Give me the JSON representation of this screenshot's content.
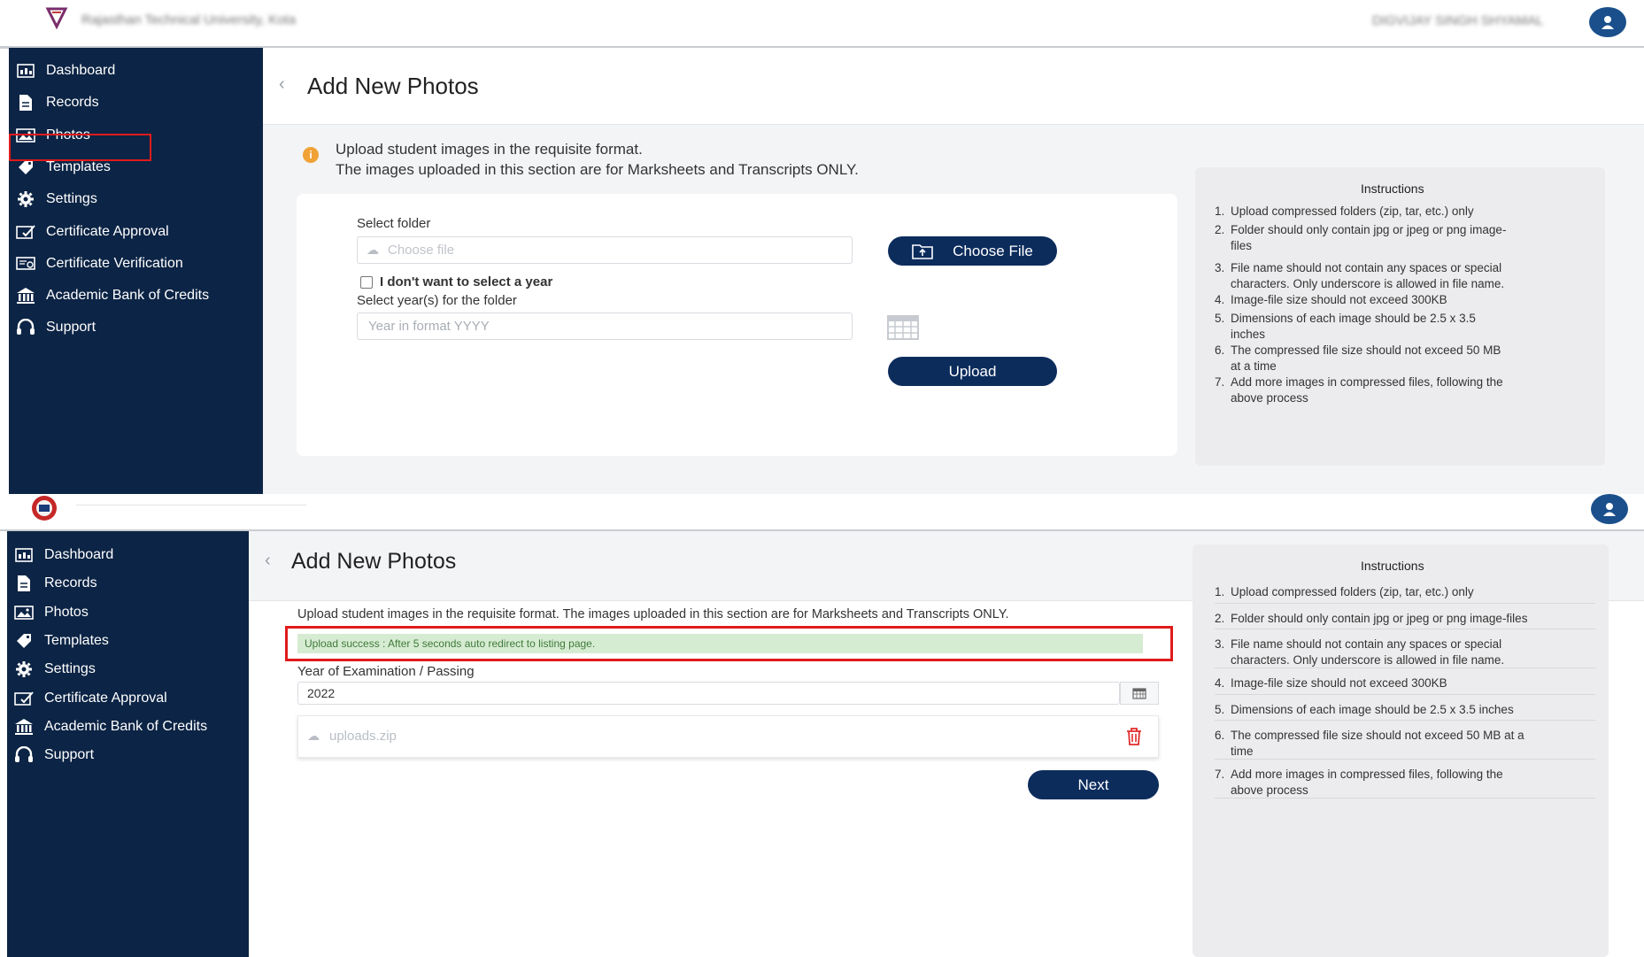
{
  "top": {
    "header": {
      "university_name": "Rajasthan Technical University, Kota",
      "user_name": "DIGVIJAY SINGH SHYAMAL"
    },
    "sidebar": {
      "items": [
        {
          "label": "Dashboard",
          "icon": "dashboard-icon"
        },
        {
          "label": "Records",
          "icon": "file-icon"
        },
        {
          "label": "Photos",
          "icon": "photos-icon"
        },
        {
          "label": "Templates",
          "icon": "tag-icon"
        },
        {
          "label": "Settings",
          "icon": "gear-icon"
        },
        {
          "label": "Certificate Approval",
          "icon": "certificate-approval-icon"
        },
        {
          "label": "Certificate Verification",
          "icon": "certificate-verification-icon"
        },
        {
          "label": "Academic Bank of Credits",
          "icon": "bank-icon"
        },
        {
          "label": "Support",
          "icon": "headset-icon"
        }
      ],
      "active": "Photos"
    },
    "page_title": "Add New Photos",
    "info_line1": "Upload student images in the requisite format.",
    "info_line2": "The images uploaded in this section are for Marksheets and Transcripts ONLY.",
    "form": {
      "select_folder_label": "Select folder",
      "file_placeholder": "Choose file",
      "choose_file_button": "Choose File",
      "no_year_checkbox_label": "I don't want to select a year",
      "no_year_checked": false,
      "select_years_label": "Select year(s) for the folder",
      "year_placeholder": "Year in format YYYY",
      "upload_button": "Upload"
    },
    "instructions": {
      "title": "Instructions",
      "items": [
        {
          "n": "1.",
          "l1": "Upload compressed folders (zip, tar, etc.) only",
          "l2": ""
        },
        {
          "n": "2.",
          "l1": "Folder should only contain jpg or jpeg or png image-",
          "l2": "files"
        },
        {
          "n": "3.",
          "l1": "File name should not contain any spaces or special",
          "l2": "characters. Only underscore is allowed in file name."
        },
        {
          "n": "4.",
          "l1": "Image-file size should not exceed 300KB",
          "l2": ""
        },
        {
          "n": "5.",
          "l1": "Dimensions of each image should be 2.5 x 3.5",
          "l2": "inches"
        },
        {
          "n": "6.",
          "l1": "The compressed file size should not exceed 50 MB",
          "l2": "at a time"
        },
        {
          "n": "7.",
          "l1": "Add more images in compressed files, following the",
          "l2": "above process"
        }
      ]
    }
  },
  "bottom": {
    "sidebar": {
      "items": [
        {
          "label": "Dashboard",
          "icon": "dashboard-icon"
        },
        {
          "label": "Records",
          "icon": "file-icon"
        },
        {
          "label": "Photos",
          "icon": "photos-icon"
        },
        {
          "label": "Templates",
          "icon": "tag-icon"
        },
        {
          "label": "Settings",
          "icon": "gear-icon"
        },
        {
          "label": "Certificate Approval",
          "icon": "certificate-approval-icon"
        },
        {
          "label": "Academic Bank of Credits",
          "icon": "bank-icon"
        },
        {
          "label": "Support",
          "icon": "headset-icon"
        }
      ]
    },
    "page_title": "Add New Photos",
    "info_line": "Upload student images in the requisite format. The images uploaded in this section are for Marksheets and Transcripts ONLY.",
    "success_message": "Upload success : After 5 seconds auto redirect to listing page.",
    "year_label": "Year of Examination / Passing",
    "year_value": "2022",
    "uploaded_file": "uploads.zip",
    "next_button": "Next",
    "instructions": {
      "title": "Instructions",
      "items": [
        {
          "n": "1.",
          "l1": "Upload compressed folders (zip, tar, etc.) only",
          "l2": ""
        },
        {
          "n": "2.",
          "l1": "Folder should only contain jpg or jpeg or png image-files",
          "l2": ""
        },
        {
          "n": "3.",
          "l1": "File name should not contain any spaces or special",
          "l2": "characters. Only underscore is allowed in file name."
        },
        {
          "n": "4.",
          "l1": "Image-file size should not exceed 300KB",
          "l2": ""
        },
        {
          "n": "5.",
          "l1": "Dimensions of each image should be 2.5 x 3.5 inches",
          "l2": ""
        },
        {
          "n": "6.",
          "l1": "The compressed file size should not exceed 50 MB at a",
          "l2": "time"
        },
        {
          "n": "7.",
          "l1": "Add more images in compressed files, following the",
          "l2": "above process"
        }
      ]
    }
  },
  "colors": {
    "sidebar": "#0c2445",
    "button": "#0c2c5c",
    "highlight_border": "#e01b1b",
    "success_bg": "#d6ecd2",
    "success_text": "#3f7a3a"
  }
}
